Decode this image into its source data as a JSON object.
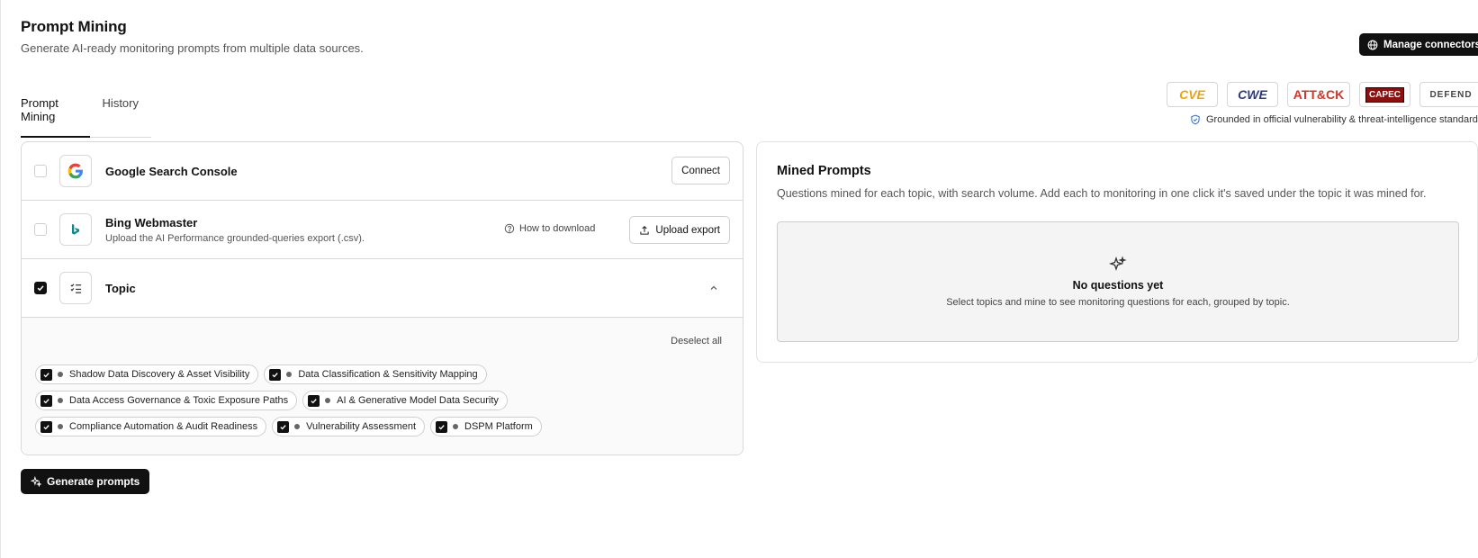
{
  "header": {
    "title": "Prompt Mining",
    "subtitle": "Generate AI-ready monitoring prompts from multiple data sources.",
    "manage_connectors_label": "Manage connectors"
  },
  "standards": {
    "logos": [
      "CVE",
      "CWE",
      "ATT&CK",
      "CAPEC",
      "DEFEND"
    ],
    "grounded_text": "Grounded in official vulnerability & threat-intelligence standards."
  },
  "tabs": [
    {
      "label": "Prompt Mining",
      "active": true
    },
    {
      "label": "History",
      "active": false
    }
  ],
  "sources": {
    "google": {
      "title": "Google Search Console",
      "connect_label": "Connect"
    },
    "bing": {
      "title": "Bing Webmaster",
      "subtitle": "Upload the AI Performance grounded-queries export (.csv).",
      "how_to_label": "How to download",
      "upload_label": "Upload export"
    },
    "topic": {
      "title": "Topic",
      "deselect_label": "Deselect all"
    }
  },
  "topics": [
    [
      "Shadow Data Discovery & Asset Visibility",
      "Data Classification & Sensitivity Mapping"
    ],
    [
      "Data Access Governance & Toxic Exposure Paths",
      "AI & Generative Model Data Security"
    ],
    [
      "Compliance Automation & Audit Readiness",
      "Vulnerability Assessment",
      "DSPM Platform"
    ]
  ],
  "generate_label": "Generate prompts",
  "mined": {
    "title": "Mined Prompts",
    "subtitle": "Questions mined for each topic, with search volume. Add each to monitoring in one click it's saved under the topic it was mined for.",
    "empty_title": "No questions yet",
    "empty_subtitle": "Select topics and mine to see monitoring questions for each, grouped by topic."
  },
  "colors": {
    "accent": "#111111",
    "cve": "#f0a30a",
    "cwe": "#2b3b80",
    "attack": "#d0362b",
    "capec": "#8c1010"
  }
}
